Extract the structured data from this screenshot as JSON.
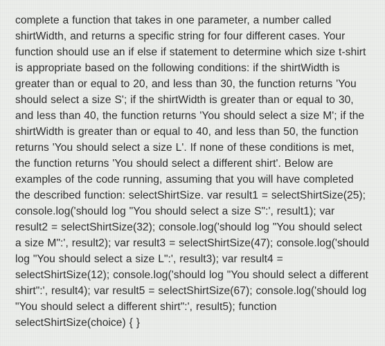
{
  "passage": {
    "text": "complete a function that takes in one parameter, a number called shirtWidth, and returns a specific string for four different cases. Your function should use an if else if statement to determine which size t-shirt is appropriate based on the following conditions: if the shirtWidth is greater than or equal to 20, and less than 30, the function returns 'You should select a size S'; if the shirtWidth is greater than or equal to 30, and less than 40, the function returns 'You should select a size M'; if the shirtWidth is greater than or equal to 40, and less than 50, the function returns 'You should select a size L'. If none of these conditions is met, the function returns 'You should select a different shirt'. Below are examples of the code running, assuming that you will have completed the described function: selectShirtSize. var result1 = selectShirtSize(25); console.log('should log \"You should select a size S\":', result1); var result2 = selectShirtSize(32); console.log('should log \"You should select a size M\":', result2); var result3 = selectShirtSize(47); console.log('should log \"You should select a size L\":', result3); var result4 = selectShirtSize(12); console.log('should log \"You should select a different shirt\":', result4); var result5 = selectShirtSize(67); console.log('should log \"You should select a different shirt\":', result5); function selectShirtSize(choice) { }"
  }
}
